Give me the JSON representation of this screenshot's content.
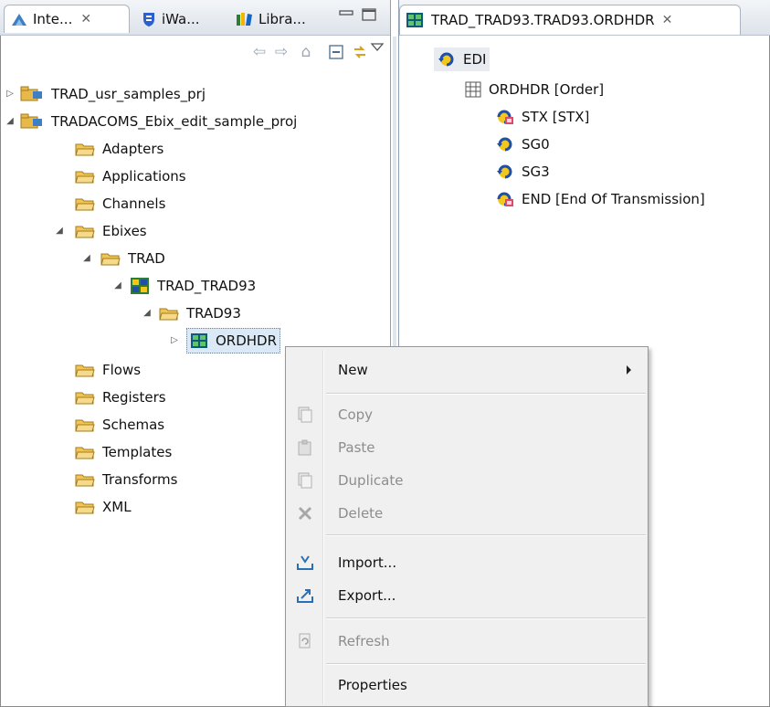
{
  "left_tabs": [
    {
      "label": "Inte...",
      "icon": "integration-explorer-icon"
    },
    {
      "label": "iWa...",
      "icon": "iway-shield-icon"
    },
    {
      "label": "Libra...",
      "icon": "library-icon"
    }
  ],
  "tree": {
    "projects": [
      {
        "label": "TRAD_usr_samples_prj",
        "expanded": false
      },
      {
        "label": "TRADACOMS_Ebix_edit_sample_proj",
        "expanded": true
      }
    ],
    "folders_top": [
      "Adapters",
      "Applications",
      "Channels"
    ],
    "ebixes": "Ebixes",
    "trad": "TRAD",
    "trad_trad93": "TRAD_TRAD93",
    "trad93": "TRAD93",
    "ordhdr": "ORDHDR",
    "folders_bottom": [
      "Flows",
      "Registers",
      "Schemas",
      "Templates",
      "Transforms",
      "XML"
    ]
  },
  "editor": {
    "tab_label": "TRAD_TRAD93.TRAD93.ORDHDR",
    "nodes": {
      "edi": "EDI",
      "ordhdr": "ORDHDR [Order]",
      "stx": "STX [STX]",
      "sg0": "SG0",
      "sg3": "SG3",
      "end": "END [End Of Transmission]"
    }
  },
  "context_menu": {
    "new": "New",
    "copy": "Copy",
    "paste": "Paste",
    "duplicate": "Duplicate",
    "delete": "Delete",
    "import": "Import...",
    "export": "Export...",
    "refresh": "Refresh",
    "properties": "Properties"
  },
  "colors": {
    "folder": "#e8b84a",
    "selection": "#dbe8f6",
    "segment_blue": "#1f4fa8",
    "segment_yellow": "#f2c81e"
  }
}
